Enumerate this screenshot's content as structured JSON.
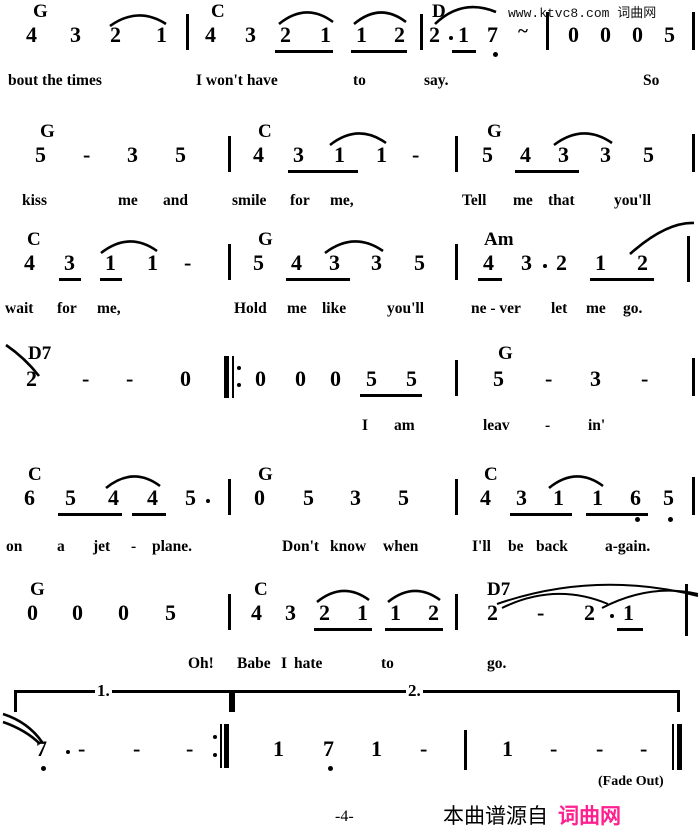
{
  "watermarks": {
    "top": "www.ktvc8.com  词曲网",
    "bottom_prefix": "本曲谱源自",
    "bottom_highlight": "词曲网",
    "bottom_highlight_color": "#ff1f8f"
  },
  "footer": {
    "fade_out": "(Fade Out)",
    "page_number": "-4-"
  },
  "score": {
    "notation": "jianpu",
    "systems": [
      {
        "id": "system-1",
        "measures": [
          {
            "chord": "G",
            "notes": [
              "4",
              "3",
              "2",
              "1"
            ]
          },
          {
            "chord": "C",
            "notes": [
              "4",
              "3",
              "2",
              "1",
              "1",
              "2"
            ]
          },
          {
            "chord": "D",
            "notes": [
              "2",
              "·",
              "1",
              "7",
              "~"
            ]
          },
          {
            "chord": "",
            "notes": [
              "0",
              "0",
              "0",
              "5"
            ]
          }
        ],
        "lyrics": [
          "bout the times",
          "I won't have",
          "to",
          "say.",
          "So"
        ]
      },
      {
        "id": "system-2",
        "measures": [
          {
            "chord": "G",
            "notes": [
              "5",
              "-",
              "3",
              "5"
            ]
          },
          {
            "chord": "C",
            "notes": [
              "4",
              "3",
              "1",
              "1",
              "-"
            ]
          },
          {
            "chord": "G",
            "notes": [
              "5",
              "4",
              "3",
              "3",
              "5"
            ]
          }
        ],
        "lyrics": [
          "kiss",
          "me",
          "and",
          "smile",
          "for",
          "me,",
          "Tell",
          "me",
          "that",
          "you'll"
        ]
      },
      {
        "id": "system-3",
        "measures": [
          {
            "chord": "C",
            "notes": [
              "4",
              "3",
              "1",
              "1",
              "-"
            ]
          },
          {
            "chord": "G",
            "notes": [
              "5",
              "4",
              "3",
              "3",
              "5"
            ]
          },
          {
            "chord": "Am",
            "notes": [
              "4",
              "3",
              "·",
              "2",
              "1",
              "2"
            ]
          }
        ],
        "lyrics": [
          "wait",
          "for",
          "me,",
          "Hold",
          "me",
          "like",
          "you'll",
          "ne - ver",
          "let",
          "me",
          "go."
        ]
      },
      {
        "id": "system-4",
        "measures": [
          {
            "chord": "D7",
            "notes": [
              "2",
              "-",
              "-",
              "0"
            ]
          },
          {
            "chord": "",
            "notes": [
              "0",
              "0",
              "0",
              "5",
              "5"
            ],
            "repeat_start": true
          },
          {
            "chord": "G",
            "notes": [
              "5",
              "-",
              "3",
              "-"
            ]
          }
        ],
        "lyrics": [
          "I",
          "am",
          "leav",
          "-",
          "in'"
        ]
      },
      {
        "id": "system-5",
        "measures": [
          {
            "chord": "C",
            "notes": [
              "6",
              "5",
              "4",
              "4",
              "5",
              "·"
            ]
          },
          {
            "chord": "G",
            "notes": [
              "0",
              "5",
              "3",
              "5"
            ]
          },
          {
            "chord": "C",
            "notes": [
              "4",
              "3",
              "1",
              "1",
              "6",
              "5"
            ]
          }
        ],
        "lyrics": [
          "on",
          "a",
          "jet",
          "-",
          "plane.",
          "Don't",
          "know",
          "when",
          "I'll",
          "be",
          "back",
          "a-gain."
        ]
      },
      {
        "id": "system-6",
        "measures": [
          {
            "chord": "G",
            "notes": [
              "0",
              "0",
              "0",
              "5"
            ]
          },
          {
            "chord": "C",
            "notes": [
              "4",
              "3",
              "2",
              "1",
              "1",
              "2"
            ]
          },
          {
            "chord": "D7",
            "notes": [
              "2",
              "-",
              "2",
              "·",
              "1"
            ]
          }
        ],
        "lyrics": [
          "Oh!",
          "Babe",
          "I",
          "hate",
          "to",
          "go."
        ]
      },
      {
        "id": "system-7-endings",
        "endings": [
          {
            "label": "1.",
            "notes": [
              "7",
              "·",
              "-",
              "-",
              "-"
            ],
            "repeat_end": true
          },
          {
            "label": "2.",
            "notes": [
              "1",
              "7",
              "1",
              "-",
              "1",
              "-",
              "-",
              "-"
            ],
            "final_barline": true
          }
        ]
      }
    ]
  }
}
